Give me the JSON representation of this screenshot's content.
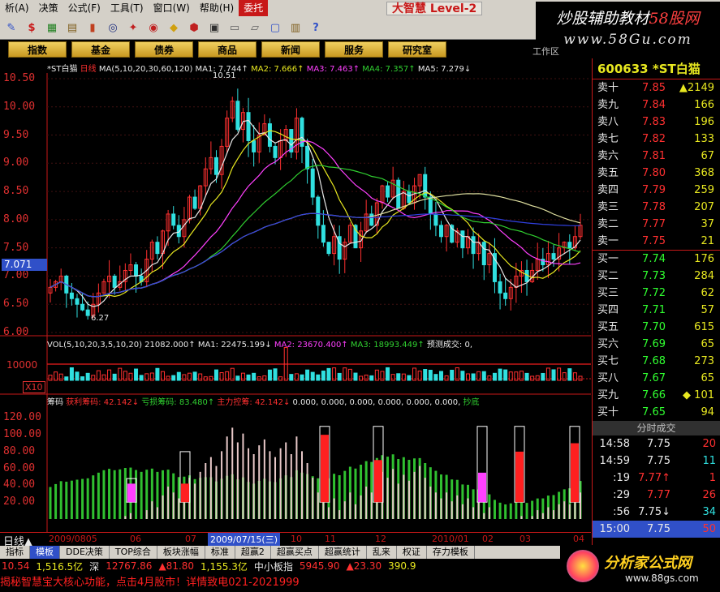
{
  "menu": {
    "items": [
      "析(A)",
      "决策",
      "公式(F)",
      "工具(T)",
      "窗口(W)",
      "帮助(H)",
      "委托"
    ],
    "active_index": 6,
    "brand": "大智慧 Level-2"
  },
  "watermark": {
    "line1_a": "炒股辅助教材",
    "line1_b": "58股网",
    "line2": "www.58Gu.com"
  },
  "toolbar": {
    "icons": [
      "pen-icon",
      "dollar-icon",
      "grid-icon",
      "grid2-icon",
      "bar-icon",
      "binoculars-icon",
      "compass-icon",
      "target-icon",
      "arrow-icon",
      "sign-icon",
      "info-icon",
      "rec-icon",
      "folder-icon",
      "window-icon",
      "books-icon",
      "help-icon"
    ]
  },
  "nav": {
    "buttons": [
      "指数",
      "基金",
      "债券",
      "商品",
      "新闻",
      "服务",
      "研究室"
    ],
    "worktab": "工作区"
  },
  "chart": {
    "ma_line": {
      "label": "*ST白猫",
      "period": "日线",
      "ma": "MA(5,10,20,30,60,120)",
      "ma1": "MA1: 7.744↑",
      "ma2": "MA2: 7.666↑",
      "ma3": "MA3: 7.463↑",
      "ma4": "MA4: 7.357↑",
      "ma5": "MA5: 7.279↓"
    },
    "high_label": "10.51",
    "low_label": "6.27",
    "cur_price": "7.071",
    "price_ticks": [
      "10.50",
      "10.00",
      "9.50",
      "9.00",
      "8.50",
      "8.00",
      "7.50",
      "7.00",
      "6.50",
      "6.00"
    ],
    "vol_line": {
      "label": "VOL(5,10,20,3,5,10,20)",
      "v": "21082.000↑",
      "ma1": "MA1: 22475.199↓",
      "ma2": "MA2: 23670.400↑",
      "ma3": "MA3: 18993.449↑",
      "pred": "预测成交: 0,"
    },
    "vol_ticks": [
      "10000",
      "X10"
    ],
    "chip_line": {
      "label": "筹码",
      "a": "获利筹码: 42.142↓",
      "b": "亏损筹码: 83.480↑",
      "c": "主力控筹: 42.142↓",
      "d": "0.000, 0.000, 0.000, 0.000,",
      "e": "0.000, 0.000,",
      "f": "抄底"
    },
    "chip_ticks": [
      "120.00",
      "100.00",
      "80.00",
      "60.00",
      "40.00",
      "20.00"
    ],
    "x_labels": [
      "2009/0805",
      "06",
      "07",
      "2009/07/15(三)",
      "10",
      "11",
      "12",
      "2010/01",
      "02",
      "03",
      "04"
    ],
    "period_label": "日线▲"
  },
  "chart_data": {
    "type": "candlestick",
    "title": "*ST白猫",
    "ylim": [
      6.0,
      10.6
    ],
    "close": [
      6.8,
      6.9,
      7.0,
      6.7,
      6.6,
      6.5,
      6.4,
      6.3,
      6.5,
      6.7,
      6.9,
      7.0,
      6.8,
      6.9,
      7.1,
      7.2,
      7.0,
      6.9,
      7.3,
      7.6,
      7.4,
      7.8,
      8.1,
      7.9,
      7.7,
      8.0,
      8.4,
      8.2,
      8.6,
      8.9,
      9.1,
      8.8,
      9.3,
      9.8,
      10.1,
      9.6,
      9.9,
      9.4,
      9.2,
      9.5,
      9.7,
      9.3,
      9.1,
      9.4,
      9.6,
      9.2,
      9.8,
      9.3,
      8.9,
      8.4,
      7.9,
      7.6,
      7.4,
      7.7,
      7.3,
      7.6,
      7.9,
      7.5,
      7.8,
      8.1,
      7.9,
      8.3,
      8.6,
      8.4,
      8.7,
      8.2,
      8.5,
      8.3,
      8.6,
      8.8,
      8.4,
      8.1,
      7.9,
      7.7,
      7.9,
      7.6,
      7.8,
      7.5,
      7.7,
      7.4,
      7.6,
      7.2,
      7.4,
      6.9,
      6.7,
      6.6,
      6.8,
      7.0,
      7.1,
      6.9,
      7.1,
      7.3,
      7.2,
      7.4,
      7.3,
      7.5,
      7.6,
      7.5,
      7.7,
      7.9
    ]
  },
  "right_panel": {
    "code": "600633",
    "name": "*ST白猫",
    "sells": [
      {
        "label": "卖十",
        "price": "7.85",
        "vol": "▲2149"
      },
      {
        "label": "卖九",
        "price": "7.84",
        "vol": "166"
      },
      {
        "label": "卖八",
        "price": "7.83",
        "vol": "196"
      },
      {
        "label": "卖七",
        "price": "7.82",
        "vol": "133"
      },
      {
        "label": "卖六",
        "price": "7.81",
        "vol": "67"
      },
      {
        "label": "卖五",
        "price": "7.80",
        "vol": "368"
      },
      {
        "label": "卖四",
        "price": "7.79",
        "vol": "259"
      },
      {
        "label": "卖三",
        "price": "7.78",
        "vol": "207"
      },
      {
        "label": "卖二",
        "price": "7.77",
        "vol": "37"
      },
      {
        "label": "卖一",
        "price": "7.75",
        "vol": "21"
      }
    ],
    "buys": [
      {
        "label": "买一",
        "price": "7.74",
        "vol": "176"
      },
      {
        "label": "买二",
        "price": "7.73",
        "vol": "284"
      },
      {
        "label": "买三",
        "price": "7.72",
        "vol": "62"
      },
      {
        "label": "买四",
        "price": "7.71",
        "vol": "57"
      },
      {
        "label": "买五",
        "price": "7.70",
        "vol": "615"
      },
      {
        "label": "买六",
        "price": "7.69",
        "vol": "65"
      },
      {
        "label": "买七",
        "price": "7.68",
        "vol": "273"
      },
      {
        "label": "买八",
        "price": "7.67",
        "vol": "65"
      },
      {
        "label": "买九",
        "price": "7.66",
        "vol": "◆ 101"
      },
      {
        "label": "买十",
        "price": "7.65",
        "vol": "94"
      }
    ],
    "trade_head": "分时成交",
    "trades": [
      {
        "t": "14:58",
        "p": "7.75",
        "v": "20",
        "pc": "wh",
        "vc": "up"
      },
      {
        "t": "14:59",
        "p": "7.75",
        "v": "11",
        "pc": "wh",
        "vc": "cy"
      },
      {
        "t": ":19",
        "p": "7.77↑",
        "v": "1",
        "pc": "up",
        "vc": "up"
      },
      {
        "t": ":29",
        "p": "7.77",
        "v": "26",
        "pc": "up",
        "vc": "up"
      },
      {
        "t": ":56",
        "p": "7.75↓",
        "v": "34",
        "pc": "wh",
        "vc": "cy"
      },
      {
        "t": "15:00",
        "p": "7.75",
        "v": "50",
        "pc": "wh",
        "vc": "up"
      }
    ]
  },
  "tabs": [
    "指标",
    "模板",
    "DDE决策",
    "TOP综合",
    "板块涨幅",
    "标准",
    "超赢2",
    "超赢买点",
    "超赢统计",
    "乱来",
    "权证",
    "存力模板"
  ],
  "tabs_active": 1,
  "index_bar": {
    "a": "10.54",
    "b": "1,516.5亿",
    "c": "深",
    "d": "12767.86",
    "e": "▲81.80",
    "f": "1,155.3亿",
    "g": "中小板指",
    "h": "5945.90",
    "i": "▲23.30",
    "j": "390.9"
  },
  "ticker": "揭秘智慧宝大核心功能，点击4月股市！详情致电021-2021999",
  "logo2": {
    "text": "分析家公式网",
    "url": "www.88gs.com"
  }
}
